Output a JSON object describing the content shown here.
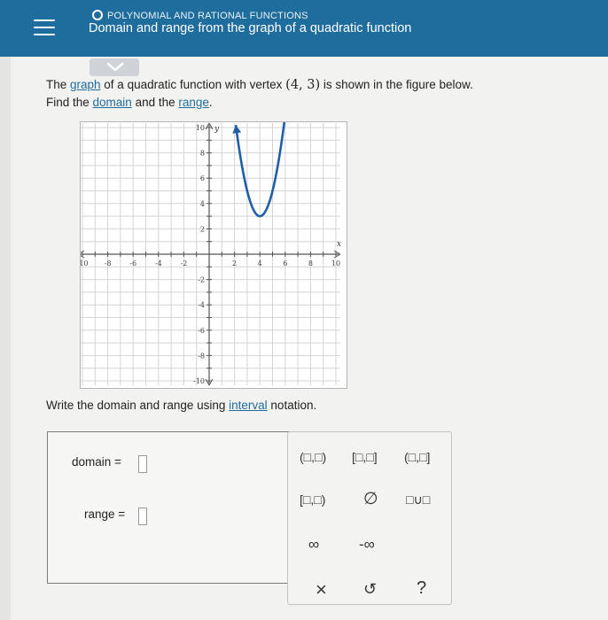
{
  "header": {
    "topic": "POLYNOMIAL AND RATIONAL FUNCTIONS",
    "title": "Domain and range from the graph of a quadratic function"
  },
  "question": {
    "line1_a": "The ",
    "graph_link": "graph",
    "line1_b": " of a quadratic function with vertex ",
    "vertex": "(4, 3)",
    "line1_c": " is shown in the figure below.",
    "line2_a": "Find the ",
    "domain_link": "domain",
    "line2_b": " and the ",
    "range_link": "range",
    "line2_c": "."
  },
  "graph": {
    "x_axis_label": "x",
    "y_axis_label": "y",
    "x_ticks": [
      "-10",
      "-8",
      "-6",
      "-4",
      "-2",
      "2",
      "4",
      "6",
      "8",
      "10"
    ],
    "y_ticks": [
      "10",
      "8",
      "6",
      "4",
      "2",
      "-2",
      "-4",
      "-6",
      "-8",
      "-10"
    ],
    "curve_color": "#1f5fa8",
    "vertex_xy": [
      4,
      3
    ],
    "left_arm_end": [
      2.1,
      10.2
    ],
    "right_arm_end": [
      6.1,
      10.2
    ]
  },
  "instruction": {
    "before": "Write the domain and range using ",
    "link": "interval",
    "after": " notation."
  },
  "answer": {
    "domain_label": "domain =",
    "range_label": "range ="
  },
  "keypad": {
    "open_open": "(□,□)",
    "closed_closed": "[□,□]",
    "open_closed": "(□,□]",
    "closed_open": "[□,□)",
    "empty_set": "∅",
    "union": "□∪□",
    "infinity": "∞",
    "neg_infinity": "-∞",
    "clear": "×",
    "undo": "↺",
    "help": "?"
  },
  "colors": {
    "header": "#1f6d9c",
    "link": "#1f6d9c",
    "curve": "#1f5fa8"
  }
}
